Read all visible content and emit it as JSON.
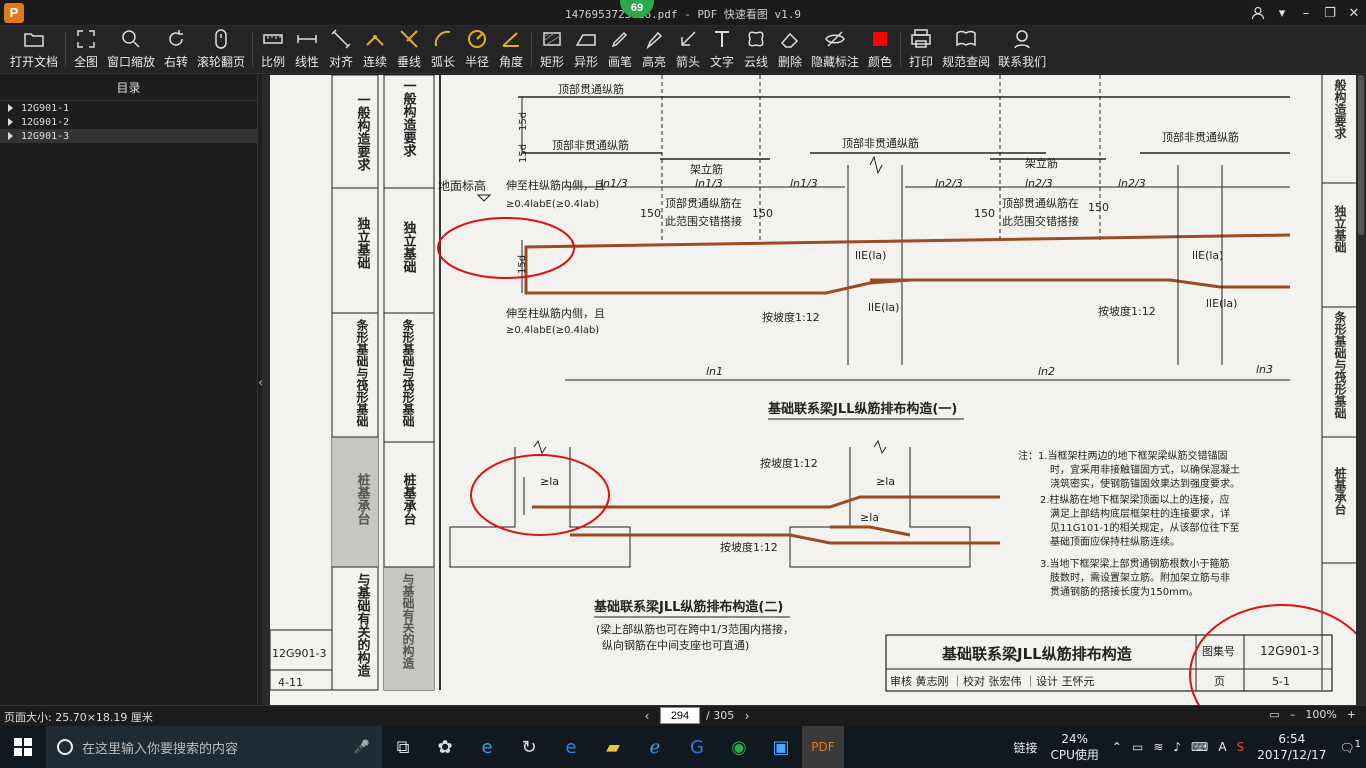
{
  "window": {
    "title": "1476953723026.pdf - PDF 快速看图 v1.9",
    "badge": "69",
    "logo": "P"
  },
  "toolbar": [
    {
      "label": "打开文档",
      "icon": "folder-icon"
    },
    {
      "label": "全图",
      "icon": "fit-all-icon"
    },
    {
      "label": "窗口缩放",
      "icon": "zoom-icon"
    },
    {
      "label": "右转",
      "icon": "rotate-right-icon"
    },
    {
      "label": "滚轮翻页",
      "icon": "mouse-wheel-icon"
    },
    {
      "label": "比例",
      "icon": "scale-icon"
    },
    {
      "label": "线性",
      "icon": "linear-dimension-icon"
    },
    {
      "label": "对齐",
      "icon": "aligned-dimension-icon"
    },
    {
      "label": "连续",
      "icon": "continuous-dimension-icon"
    },
    {
      "label": "垂线",
      "icon": "perpendicular-icon"
    },
    {
      "label": "弧长",
      "icon": "arc-length-icon"
    },
    {
      "label": "半径",
      "icon": "radius-icon"
    },
    {
      "label": "角度",
      "icon": "angle-icon"
    },
    {
      "label": "矩形",
      "icon": "rectangle-icon"
    },
    {
      "label": "异形",
      "icon": "irregular-shape-icon"
    },
    {
      "label": "画笔",
      "icon": "pen-icon"
    },
    {
      "label": "高亮",
      "icon": "highlighter-icon"
    },
    {
      "label": "箭头",
      "icon": "arrow-icon"
    },
    {
      "label": "文字",
      "icon": "text-icon"
    },
    {
      "label": "云线",
      "icon": "cloud-line-icon"
    },
    {
      "label": "删除",
      "icon": "eraser-icon"
    },
    {
      "label": "隐藏标注",
      "icon": "hide-annotations-icon"
    },
    {
      "label": "颜色",
      "icon": "color-swatch-icon"
    },
    {
      "label": "打印",
      "icon": "printer-icon"
    },
    {
      "label": "规范查阅",
      "icon": "book-search-icon"
    },
    {
      "label": "联系我们",
      "icon": "contact-icon"
    }
  ],
  "sidebar": {
    "title": "目录",
    "items": [
      {
        "label": "12G901-1",
        "selected": false
      },
      {
        "label": "12G901-2",
        "selected": false
      },
      {
        "label": "12G901-3",
        "selected": true
      }
    ]
  },
  "document": {
    "sidetabs_left": [
      "一般构造要求",
      "独立基础",
      "条形基础与筏形基础",
      "桩基承台",
      "与基础有关的构造"
    ],
    "sidetabs_inner": [
      "一般构造要求",
      "独立基础",
      "条形基础与筏形基础",
      "桩基承台",
      "与基础有关的构造"
    ],
    "left_code": "12G901-3",
    "left_page": "4-11",
    "labels": {
      "top_through": "顶部贯通纵筋",
      "top_non_through_1": "顶部非贯通纵筋",
      "top_non_through_2": "顶部非贯通纵筋",
      "top_non_through_3": "顶部非贯通纵筋",
      "erect_1": "架立筋",
      "erect_2": "架立筋",
      "ground": "地面标高",
      "col_1": "伸至柱纵筋内侧，且",
      "col_1b": "≥0.4labE(≥0.4lab)",
      "col_2": "伸至柱纵筋内侧，且",
      "col_2b": "≥0.4labE(≥0.4lab)",
      "splice_1": "顶部贯通纵筋在",
      "splice_1b": "此范围交错搭接",
      "splice_2": "顶部贯通纵筋在",
      "splice_2b": "此范围交错搭接",
      "ln1_3a": "ln1/3",
      "ln1_3b": "ln1/3",
      "ln1_3c": "ln1/3",
      "ln2_3a": "ln2/3",
      "ln2_3b": "ln2/3",
      "ln2_3c": "ln2/3",
      "d150a": "150",
      "d150b": "150",
      "d150c": "150",
      "d150d": "150",
      "lle1": "llE(la)",
      "lle2": "llE(la)",
      "lle3": "llE(la)",
      "lle4": "llE(la)",
      "slope_1": "按坡度1:12",
      "slope_2": "按坡度1:12",
      "slope_3": "按坡度1:12",
      "slope_4": "按坡度1:12",
      "ln1": "ln1",
      "ln2": "ln2",
      "ln3": "ln3",
      "d15a": "15d",
      "d15b": "15d",
      "d15c": "15d",
      "la_1": "≥la",
      "la_2": "≥la",
      "la_3": "≥la"
    },
    "caption_1": "基础联系梁JLL纵筋排布构造(一)",
    "caption_2": "基础联系梁JLL纵筋排布构造(二)",
    "caption_2_note_1": "(梁上部纵筋也可在跨中1/3范围内搭接，",
    "caption_2_note_2": "纵向钢筋在中间支座也可直通)",
    "notes": [
      "注：1.当框架柱两边的地下框架梁纵筋交错锚固",
      "时，宜采用非接触锚固方式，以确保混凝土",
      "浇筑密实，使钢筋锚固效果达到强度要求。",
      "2.柱纵筋在地下框架梁顶面以上的连接，应",
      "满足上部结构底层框架柱的连接要求，详",
      "见11G101-1的相关规定，从该部位往下至",
      "基础顶面应保持柱纵筋连续。",
      "3.当地下框架梁上部贯通钢筋根数小于箍筋",
      "肢数时，需设置架立筋。附加架立筋与非",
      "贯通钢筋的搭接长度为150mm。"
    ],
    "title_block": {
      "title": "基础联系梁JLL纵筋排布构造",
      "atlas_label": "图集号",
      "atlas_no": "12G901-3",
      "review_row": "审核 黄志刚 ｜校对 张宏伟 ｜设计 王怀元",
      "page_label": "页",
      "page_no": "5-1"
    },
    "right_tabs": [
      "般构造要求",
      "独立基础",
      "条形基础与筏形基础",
      "桩基承台"
    ]
  },
  "statusbar": {
    "page_size": "页面大小: 25.70×18.19 厘米",
    "current_page": "294",
    "total_pages": "/ 305",
    "zoom": "100%"
  },
  "taskbar": {
    "search_placeholder": "在这里输入你要搜索的内容",
    "tray_link": "链接",
    "cpu_percent": "24%",
    "cpu_label": "CPU使用",
    "time": "6:54",
    "date": "2017/12/17",
    "notification_count": "1"
  },
  "colors": {
    "rebar": "#9c4a22",
    "markup_red": "#e01010",
    "paper": "#f4f2ee",
    "toolbar_bg": "#242424"
  }
}
